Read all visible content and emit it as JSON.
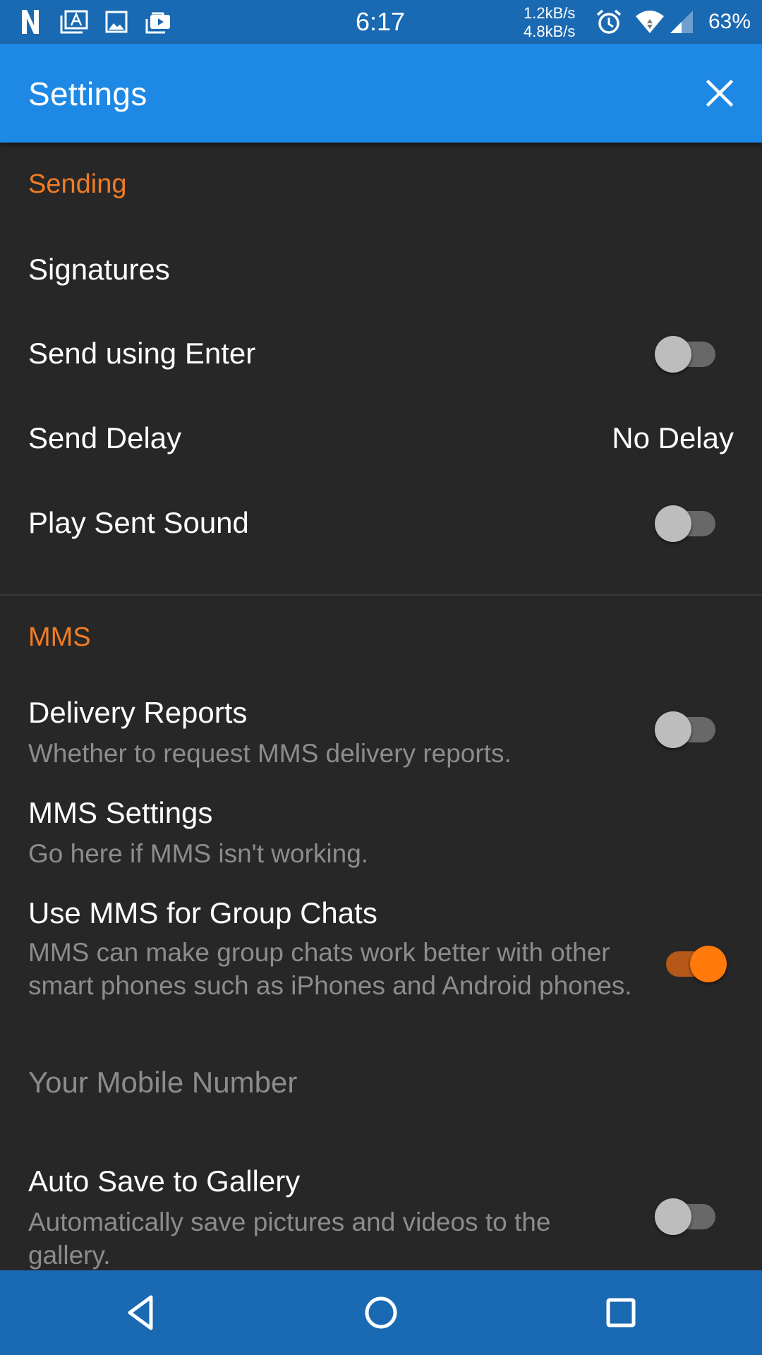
{
  "status_bar": {
    "time": "6:17",
    "upload_speed": "1.2kB/s",
    "download_speed": "4.8kB/s",
    "battery": "63%",
    "icons": [
      "netflix-n-icon",
      "text-image-icon",
      "gallery-icon",
      "video-briefcase-icon",
      "alarm-icon",
      "wifi-icon",
      "signal-icon"
    ]
  },
  "app_bar": {
    "title": "Settings",
    "close_icon": "close-icon"
  },
  "sections": {
    "sending": {
      "header": "Sending",
      "items": {
        "signatures": {
          "title": "Signatures"
        },
        "send_using_enter": {
          "title": "Send using Enter",
          "enabled": false
        },
        "send_delay": {
          "title": "Send Delay",
          "value": "No Delay"
        },
        "play_sent_sound": {
          "title": "Play Sent Sound",
          "enabled": false
        }
      }
    },
    "mms": {
      "header": "MMS",
      "items": {
        "delivery_reports": {
          "title": "Delivery Reports",
          "summary": "Whether to request MMS delivery reports.",
          "enabled": false
        },
        "mms_settings": {
          "title": "MMS Settings",
          "summary": "Go here if MMS isn't working."
        },
        "group_chats": {
          "title": "Use MMS for Group Chats",
          "summary": "MMS can make group chats work better with other smart phones such as iPhones and Android phones.",
          "enabled": true
        },
        "mobile_number": {
          "placeholder": "Your Mobile Number"
        },
        "auto_save": {
          "title": "Auto Save to Gallery",
          "summary": "Automatically save pictures and videos to the gallery.",
          "enabled": false
        }
      }
    }
  },
  "nav_bar": {
    "back": "back-icon",
    "home": "home-icon",
    "recents": "recents-icon"
  },
  "colors": {
    "status_bar": "#1a69b3",
    "app_bar": "#1e88e5",
    "background": "#272727",
    "accent": "#f07c24",
    "toggle_on": "#ff7a0a"
  }
}
